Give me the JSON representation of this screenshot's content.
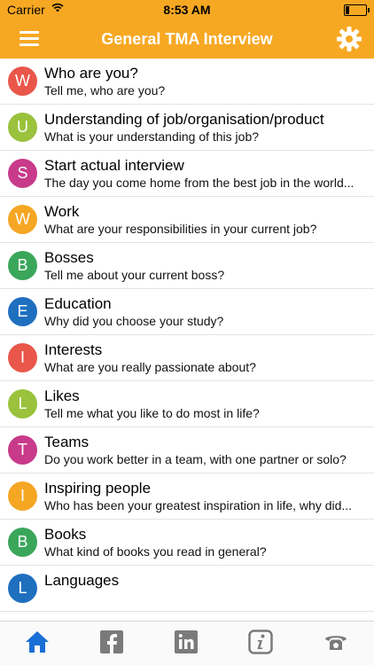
{
  "status": {
    "carrier": "Carrier",
    "time": "8:53 AM"
  },
  "header": {
    "title": "General TMA Interview"
  },
  "colors": {
    "accent": "#f7a823",
    "tab_active": "#1a6fd6",
    "tab_inactive": "#7a7a7a"
  },
  "items": [
    {
      "letter": "W",
      "title": "Who are you?",
      "subtitle": "Tell me, who are you?",
      "color": "#e8574a"
    },
    {
      "letter": "U",
      "title": "Understanding of job/organisation/product",
      "subtitle": "What is your understanding of this job?",
      "color": "#9ac23c"
    },
    {
      "letter": "S",
      "title": "Start actual interview",
      "subtitle": "The day you come home from the best job in the world...",
      "color": "#c83a8a"
    },
    {
      "letter": "W",
      "title": "Work",
      "subtitle": "What are your responsibilities in your current job?",
      "color": "#f5a623"
    },
    {
      "letter": "B",
      "title": "Bosses",
      "subtitle": "Tell me about your current boss?",
      "color": "#3aa65a"
    },
    {
      "letter": "E",
      "title": "Education",
      "subtitle": "Why did you choose your study?",
      "color": "#1f6fbf"
    },
    {
      "letter": "I",
      "title": "Interests",
      "subtitle": "What are you really passionate about?",
      "color": "#e8574a"
    },
    {
      "letter": "L",
      "title": "Likes",
      "subtitle": "Tell me what you like to do most in life?",
      "color": "#9ac23c"
    },
    {
      "letter": "T",
      "title": "Teams",
      "subtitle": "Do you work better in a team, with one partner or solo?",
      "color": "#c83a8a"
    },
    {
      "letter": "I",
      "title": "Inspiring people",
      "subtitle": "Who has been your greatest inspiration in life, why did...",
      "color": "#f5a623"
    },
    {
      "letter": "B",
      "title": "Books",
      "subtitle": "What kind of books you read in general?",
      "color": "#3aa65a"
    },
    {
      "letter": "L",
      "title": "Languages",
      "subtitle": "",
      "color": "#1f6fbf"
    }
  ],
  "tabs": [
    {
      "icon": "home-icon",
      "active": true
    },
    {
      "icon": "facebook-icon",
      "active": false
    },
    {
      "icon": "linkedin-icon",
      "active": false
    },
    {
      "icon": "info-icon",
      "active": false
    },
    {
      "icon": "phone-icon",
      "active": false
    }
  ]
}
